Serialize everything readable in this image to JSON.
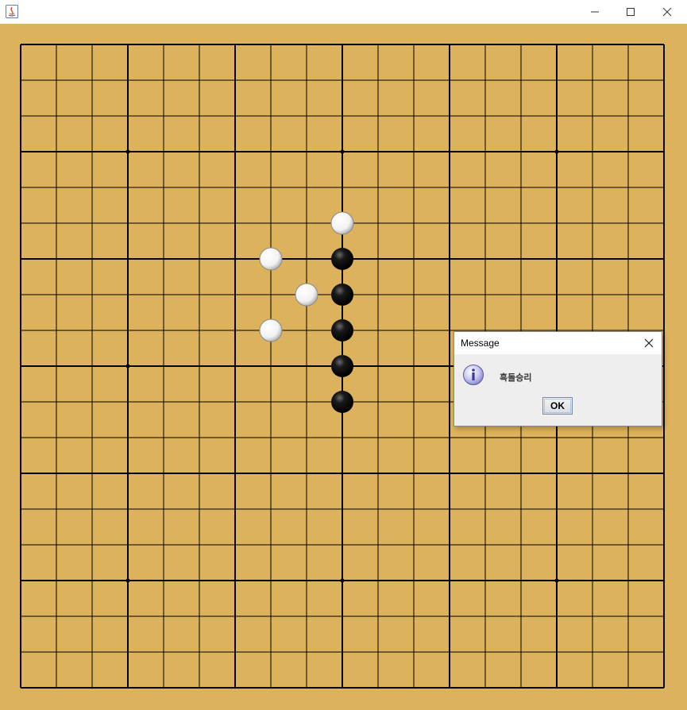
{
  "board": {
    "size": 19,
    "background_color": "#dcb35c",
    "line_color": "#000000",
    "star_points": [
      [
        3,
        3
      ],
      [
        9,
        3
      ],
      [
        15,
        3
      ],
      [
        3,
        9
      ],
      [
        9,
        9
      ],
      [
        15,
        9
      ],
      [
        3,
        15
      ],
      [
        9,
        15
      ],
      [
        15,
        15
      ]
    ],
    "stones": [
      {
        "color": "white",
        "col": 9,
        "row": 5
      },
      {
        "color": "white",
        "col": 7,
        "row": 6
      },
      {
        "color": "black",
        "col": 9,
        "row": 6
      },
      {
        "color": "white",
        "col": 8,
        "row": 7
      },
      {
        "color": "black",
        "col": 9,
        "row": 7
      },
      {
        "color": "white",
        "col": 7,
        "row": 8
      },
      {
        "color": "black",
        "col": 9,
        "row": 8
      },
      {
        "color": "black",
        "col": 9,
        "row": 9
      },
      {
        "color": "black",
        "col": 9,
        "row": 10
      }
    ]
  },
  "dialog": {
    "title": "Message",
    "message": "흑돌승리",
    "ok_label": "OK",
    "icon": "information-icon"
  },
  "window": {
    "app_icon": "java-icon",
    "controls": [
      "minimize-icon",
      "maximize-icon",
      "close-icon"
    ]
  }
}
